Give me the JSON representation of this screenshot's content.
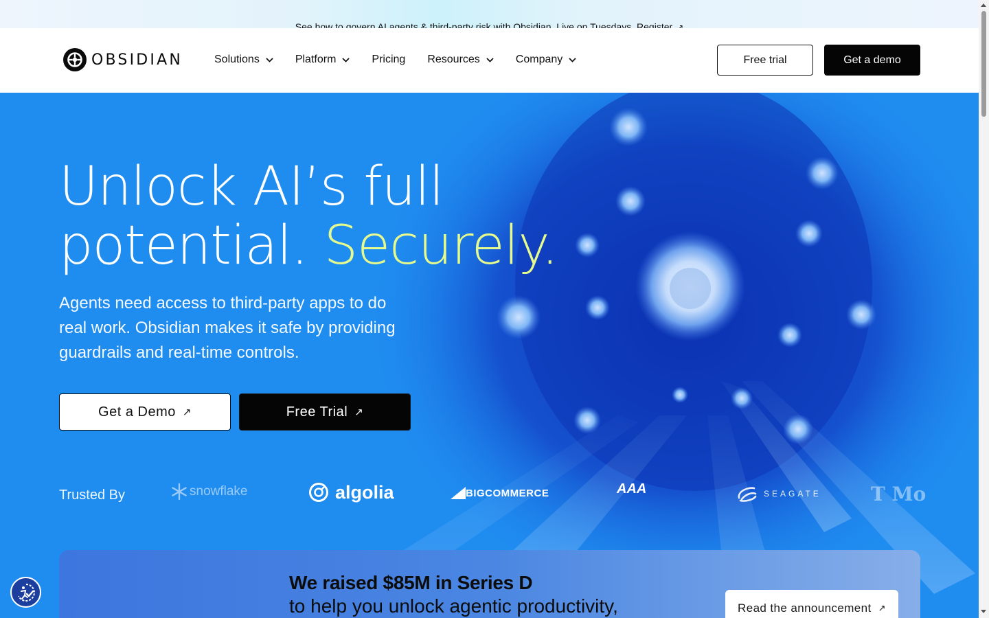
{
  "announcement": {
    "text": "See how to govern AI agents & third-party risk with Obsidian. Live on Tuesdays. Register",
    "arrow": "↗"
  },
  "nav": {
    "logo_text": "OBSIDIAN",
    "menu": [
      {
        "label": "Solutions",
        "has_dropdown": true
      },
      {
        "label": "Platform",
        "has_dropdown": true
      },
      {
        "label": "Pricing",
        "has_dropdown": false
      },
      {
        "label": "Resources",
        "has_dropdown": true
      },
      {
        "label": "Company",
        "has_dropdown": true
      }
    ],
    "free_trial_label": "Free trial",
    "get_demo_label": "Get a demo"
  },
  "hero": {
    "headline_line1": "Unlock AI’s full",
    "headline_line2_prefix": "potential. ",
    "headline_highlight": "Securely.",
    "subtext": "Agents need access to third-party apps to do real work. Obsidian makes it safe by providing guardrails and real-time controls.",
    "cta_demo_label": "Get a Demo",
    "cta_trial_label": "Free Trial",
    "cta_arrow": "↗",
    "trusted_label": "Trusted By",
    "brands": [
      "snowflake",
      "algolia",
      "BIGCOMMERCE",
      "AAA",
      "SEAGATE",
      "T Mo"
    ]
  },
  "announcement_card": {
    "title": "We raised $85M in Series D",
    "subtitle": "to help you unlock agentic productivity,",
    "button_label": "Read the announcement"
  },
  "colors": {
    "hero_blue": "#1f8cf0",
    "highlight": "#e6fb8e",
    "dark": "#050505",
    "a11y_badge": "#1c3f9f"
  },
  "icons": [
    "chevron-down-icon",
    "arrow-up-right-icon",
    "obsidian-logo-icon",
    "accessibility-icon"
  ]
}
